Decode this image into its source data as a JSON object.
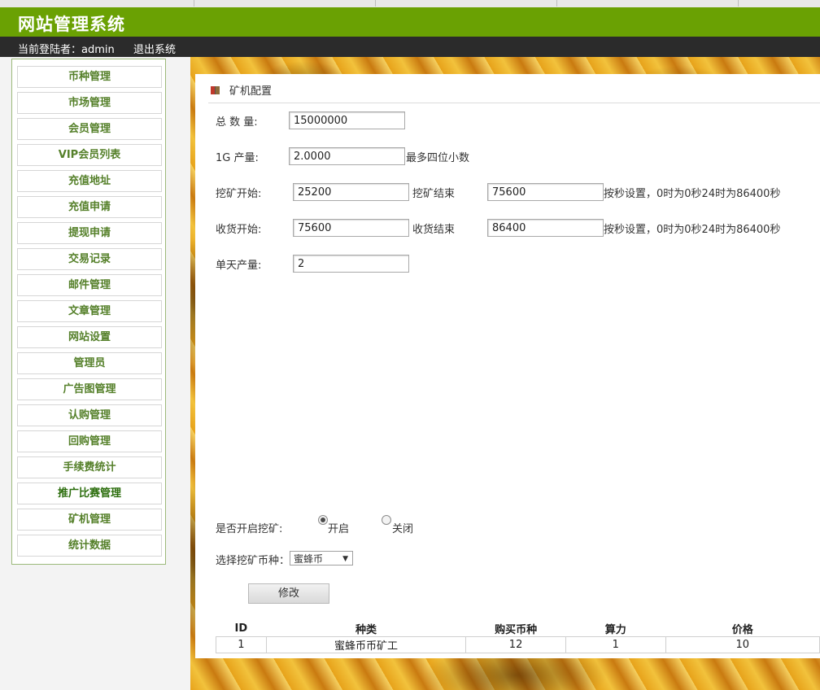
{
  "header": {
    "title": "网站管理系统"
  },
  "subbar": {
    "login_label": "当前登陆者：admin",
    "logout": "退出系统"
  },
  "sidebar": {
    "items": [
      {
        "label": "币种管理"
      },
      {
        "label": "市场管理"
      },
      {
        "label": "会员管理"
      },
      {
        "label": "VIP会员列表"
      },
      {
        "label": "充值地址"
      },
      {
        "label": "充值申请"
      },
      {
        "label": "提现申请"
      },
      {
        "label": "交易记录"
      },
      {
        "label": "邮件管理"
      },
      {
        "label": "文章管理"
      },
      {
        "label": "网站设置"
      },
      {
        "label": "管理员"
      },
      {
        "label": "广告图管理"
      },
      {
        "label": "认购管理"
      },
      {
        "label": "回购管理"
      },
      {
        "label": "手续费统计"
      },
      {
        "label": "推广比赛管理"
      },
      {
        "label": "矿机管理"
      },
      {
        "label": "统计数据"
      }
    ]
  },
  "panel": {
    "title": "矿机配置",
    "icon": "book-icon"
  },
  "form": {
    "total_label": "总 数 量:",
    "total_value": "15000000",
    "output_label": "1G 产量:",
    "output_value": "2.0000",
    "output_hint": "最多四位小数",
    "mine_start_label": "挖矿开始:",
    "mine_start_value": "25200",
    "mine_end_label": "挖矿结束",
    "mine_end_value": "75600",
    "mine_hint": "按秒设置，0时为0秒24时为86400秒",
    "harvest_start_label": "收货开始:",
    "harvest_start_value": "75600",
    "harvest_end_label": "收货结束",
    "harvest_end_value": "86400",
    "harvest_hint": "按秒设置，0时为0秒24时为86400秒",
    "daily_label": "单天产量:",
    "daily_value": "2",
    "enable_label": "是否开启挖矿:",
    "enable_on": "开启",
    "enable_off": "关闭",
    "enable_selected": "开启",
    "coin_label": "选择挖矿币种：",
    "coin_selected": "蜜蜂币",
    "submit": "修改"
  },
  "table": {
    "headers": [
      "ID",
      "种类",
      "购买币种",
      "算力",
      "价格"
    ],
    "rows": [
      {
        "id": "1",
        "type": "蜜蜂币币矿工",
        "coin": "12",
        "power": "1",
        "price": "10"
      }
    ]
  },
  "colors": {
    "header_green": "#6aa103",
    "subbar": "#2b2b2b",
    "menu_text": "#55802a"
  }
}
